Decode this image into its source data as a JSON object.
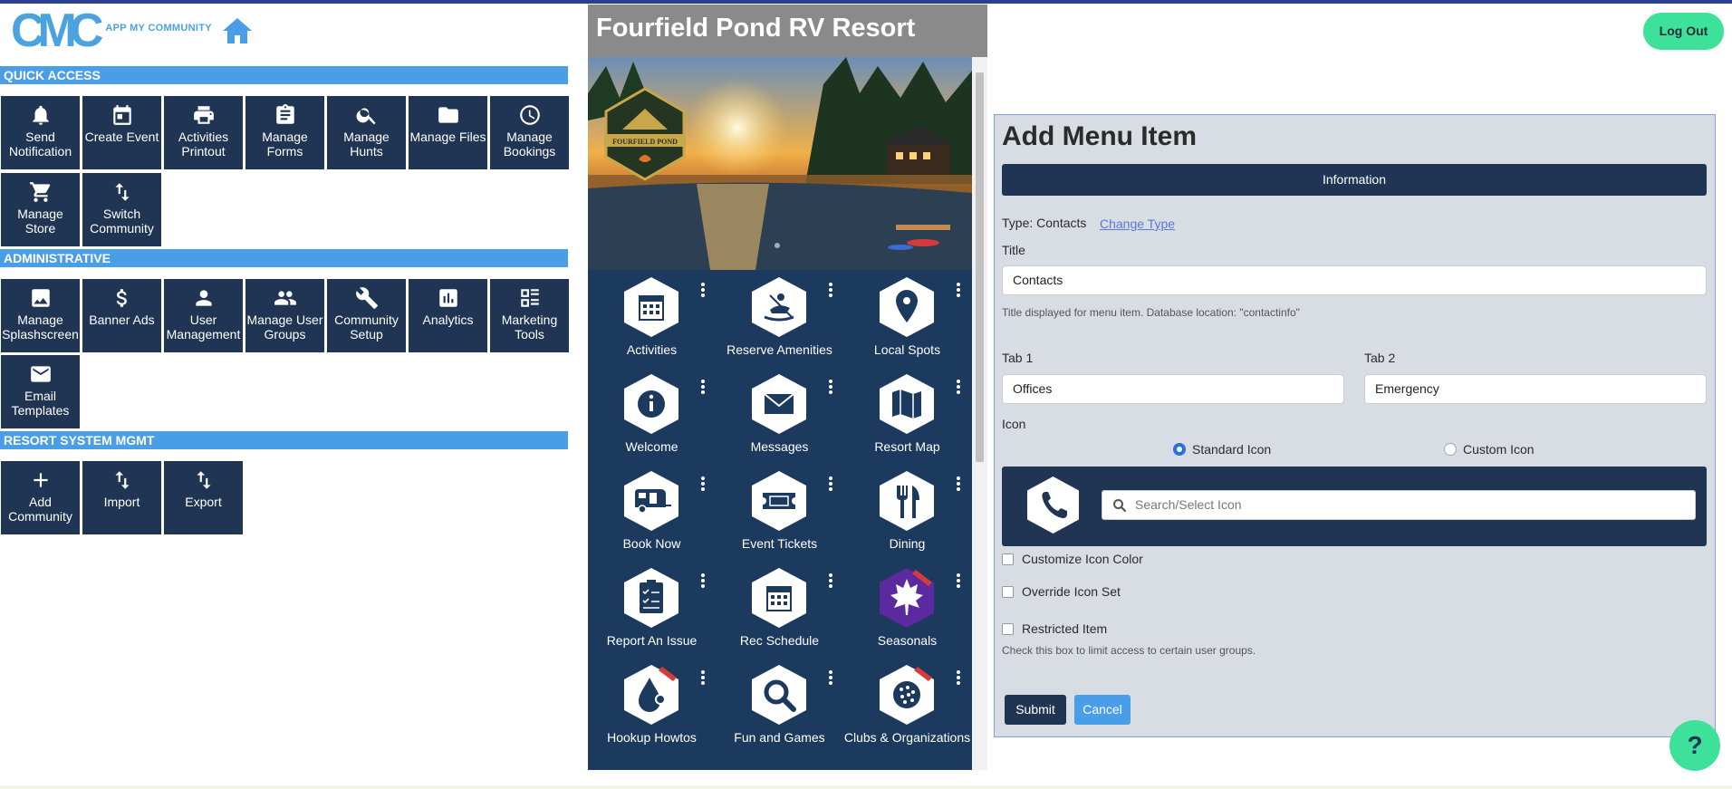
{
  "brand": {
    "logo_mark": "CMC",
    "logo_text": "APP MY COMMUNITY"
  },
  "sections": {
    "quick_access": "QUICK ACCESS",
    "administrative": "ADMINISTRATIVE",
    "resort": "RESORT SYSTEM MGMT"
  },
  "quick_access": [
    {
      "label": "Send Notification",
      "icon": "bell-icon"
    },
    {
      "label": "Create Event",
      "icon": "calendar-icon"
    },
    {
      "label": "Activities Printout",
      "icon": "printer-icon"
    },
    {
      "label": "Manage Forms",
      "icon": "clipboard-icon"
    },
    {
      "label": "Manage Hunts",
      "icon": "search-icon"
    },
    {
      "label": "Manage Files",
      "icon": "folder-icon"
    },
    {
      "label": "Manage Bookings",
      "icon": "clock-icon"
    },
    {
      "label": "Manage Store",
      "icon": "cart-icon"
    },
    {
      "label": "Switch Community",
      "icon": "swap-icon"
    }
  ],
  "administrative": [
    {
      "label": "Manage Splashscreen",
      "icon": "image-icon"
    },
    {
      "label": "Banner Ads",
      "icon": "dollar-icon"
    },
    {
      "label": "User Management",
      "icon": "user-icon"
    },
    {
      "label": "Manage User Groups",
      "icon": "users-icon"
    },
    {
      "label": "Community Setup",
      "icon": "wrench-icon"
    },
    {
      "label": "Analytics",
      "icon": "chart-icon"
    },
    {
      "label": "Marketing Tools",
      "icon": "grid-icon"
    },
    {
      "label": "Email Templates",
      "icon": "mail-icon"
    }
  ],
  "resort": [
    {
      "label": "Add Community",
      "icon": "plus-icon"
    },
    {
      "label": "Import",
      "icon": "import-icon"
    },
    {
      "label": "Export",
      "icon": "export-icon"
    }
  ],
  "phone": {
    "title": "Fourfield Pond RV Resort",
    "badge_text": "FOURFIELD POND",
    "apps": [
      {
        "label": "Activities",
        "icon": "calendar-icon"
      },
      {
        "label": "Reserve Amenities",
        "icon": "kayak-icon"
      },
      {
        "label": "Local Spots",
        "icon": "map-pin-icon"
      },
      {
        "label": "Welcome",
        "icon": "info-icon"
      },
      {
        "label": "Messages",
        "icon": "envelope-icon"
      },
      {
        "label": "Resort Map",
        "icon": "map-icon"
      },
      {
        "label": "Book Now",
        "icon": "camper-icon"
      },
      {
        "label": "Event Tickets",
        "icon": "ticket-icon"
      },
      {
        "label": "Dining",
        "icon": "utensils-icon"
      },
      {
        "label": "Report An Issue",
        "icon": "checklist-icon"
      },
      {
        "label": "Rec Schedule",
        "icon": "calendar-icon"
      },
      {
        "label": "Seasonals",
        "icon": "maple-leaf-icon"
      },
      {
        "label": "Hookup Howtos",
        "icon": "droplet-icon"
      },
      {
        "label": "Fun and Games",
        "icon": "magnifier-icon"
      },
      {
        "label": "Clubs & Organizations",
        "icon": "ball-icon"
      }
    ]
  },
  "header": {
    "logout": "Log Out"
  },
  "form": {
    "heading": "Add Menu Item",
    "info_tab": "Information",
    "type_label": "Type: Contacts",
    "change_type": "Change Type",
    "title_label": "Title",
    "title_value": "Contacts",
    "title_hint": "Title displayed for menu item. Database location: \"contactinfo\"",
    "tab1_label": "Tab 1",
    "tab1_value": "Offices",
    "tab2_label": "Tab 2",
    "tab2_value": "Emergency",
    "icon_label": "Icon",
    "radio_standard": "Standard Icon",
    "radio_custom": "Custom Icon",
    "search_placeholder": "Search/Select Icon",
    "customize_color": "Customize Icon Color",
    "override_set": "Override Icon Set",
    "restricted": "Restricted Item",
    "restricted_hint": "Check this box to limit access to certain user groups.",
    "submit": "Submit",
    "cancel": "Cancel"
  },
  "help": "?",
  "colors": {
    "navy": "#1f3553",
    "accent_blue": "#4a9ee8",
    "green": "#3ee19a"
  }
}
